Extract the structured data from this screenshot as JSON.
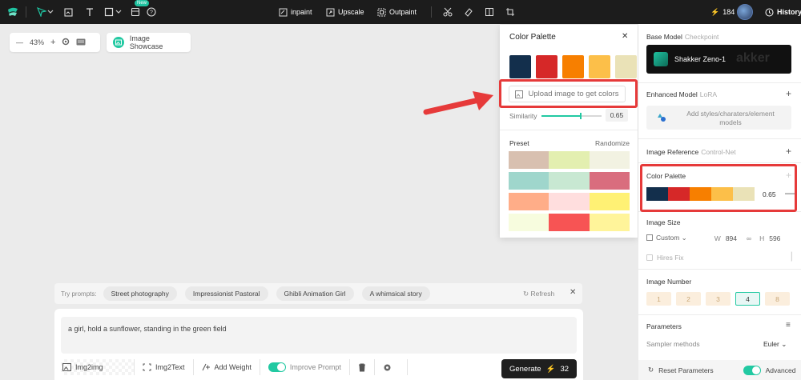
{
  "topbar": {
    "new_badge": "New",
    "inpaint": "inpaint",
    "upscale": "Upscale",
    "outpaint": "Outpaint",
    "credits": "184",
    "history": "History"
  },
  "canvas": {
    "zoom": "43%",
    "showcase_label": "Image Showcase"
  },
  "prompts": {
    "label": "Try prompts:",
    "chips": [
      "Street photography",
      "Impressionist Pastoral",
      "Ghibli Animation Girl",
      "A whimsical story"
    ],
    "refresh": "Refresh",
    "text": "a girl, hold a sunflower, standing in the green field"
  },
  "tools": {
    "img2img": "Img2img",
    "img2text": "Img2Text",
    "add_weight": "Add Weight",
    "improve_prompt": "Improve Prompt",
    "generate": "Generate",
    "generate_cost": "32"
  },
  "palette_popup": {
    "title": "Color Palette",
    "swatches": [
      "#132f4c",
      "#d62828",
      "#f77f00",
      "#fcbf49",
      "#eae2b7"
    ],
    "upload_label": "Upload image to get colors",
    "similarity_label": "Similarity",
    "similarity_value": "0.65",
    "similarity_fraction": 0.65,
    "preset_label": "Preset",
    "randomize_label": "Randomize",
    "presets": [
      [
        "#d8c0b0",
        "#e3efb0",
        "#f2f2e2"
      ],
      [
        "#9fd6cc",
        "#c8e8d2",
        "#d96d7e"
      ],
      [
        "#ffad88",
        "#ffdede",
        "#fff174"
      ],
      [
        "#f7fcde",
        "#f75454",
        "#fff49a"
      ]
    ]
  },
  "right_panel": {
    "base_model_title": "Base Model",
    "base_model_sub": "Checkpoint",
    "model_name": "Shakker Zeno-1",
    "model_bg_text": "akker",
    "enhanced_title": "Enhanced Model",
    "enhanced_sub": "LoRA",
    "lora_placeholder": "Add styles/charaters/element models",
    "image_ref_title": "Image Reference",
    "image_ref_sub": "Control-Net",
    "color_palette_title": "Color Palette",
    "color_palette_value": "0.65",
    "image_size_title": "Image Size",
    "size_mode": "Custom",
    "w_label": "W",
    "w_value": "894",
    "h_label": "H",
    "h_value": "596",
    "hires_fix": "Hires Fix",
    "image_number_title": "Image Number",
    "numbers": [
      "1",
      "2",
      "3",
      "4",
      "8"
    ],
    "active_number": "4",
    "parameters_title": "Parameters",
    "sampler_label": "Sampler methods",
    "sampler_value": "Euler",
    "reset_label": "Reset Parameters",
    "advanced_label": "Advanced"
  }
}
